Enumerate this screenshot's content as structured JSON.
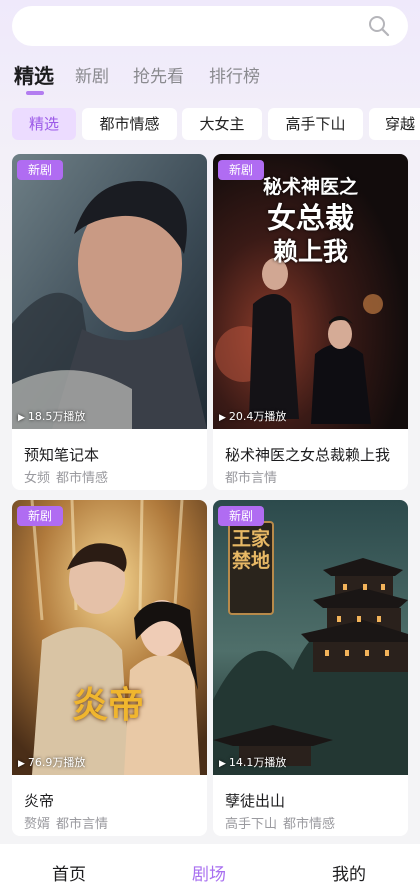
{
  "search": {
    "placeholder": "",
    "icon": "search-icon"
  },
  "tabs": [
    {
      "label": "精选",
      "active": true
    },
    {
      "label": "新剧",
      "active": false
    },
    {
      "label": "抢先看",
      "active": false
    },
    {
      "label": "排行榜",
      "active": false
    }
  ],
  "chips": [
    {
      "label": "精选",
      "active": true
    },
    {
      "label": "都市情感",
      "active": false
    },
    {
      "label": "大女主",
      "active": false
    },
    {
      "label": "高手下山",
      "active": false
    },
    {
      "label": "穿越",
      "active": false
    }
  ],
  "cards": [
    {
      "badge": "新剧",
      "plays": "18.5万播放",
      "title": "预知笔记本",
      "tags": [
        "女频",
        "都市情感"
      ]
    },
    {
      "badge": "新剧",
      "plays": "20.4万播放",
      "title": "秘术神医之女总裁赖上我",
      "tags": [
        "都市言情"
      ],
      "poster_text": [
        "秘术神医之",
        "女总裁",
        "赖上我"
      ]
    },
    {
      "badge": "新剧",
      "plays": "76.9万播放",
      "title": "炎帝",
      "tags": [
        "赘婿",
        "都市言情"
      ],
      "poster_text": [
        "炎帝"
      ]
    },
    {
      "badge": "新剧",
      "plays": "14.1万播放",
      "title": "孽徒出山",
      "tags": [
        "高手下山",
        "都市情感"
      ],
      "poster_text": [
        "王家禁地"
      ]
    }
  ],
  "bottom_nav": [
    {
      "label": "首页",
      "active": false
    },
    {
      "label": "剧场",
      "active": true
    },
    {
      "label": "我的",
      "active": false
    }
  ],
  "colors": {
    "accent": "#a86ff0",
    "badge": "#b06cf2",
    "chip_active_bg": "#ecdcff"
  }
}
